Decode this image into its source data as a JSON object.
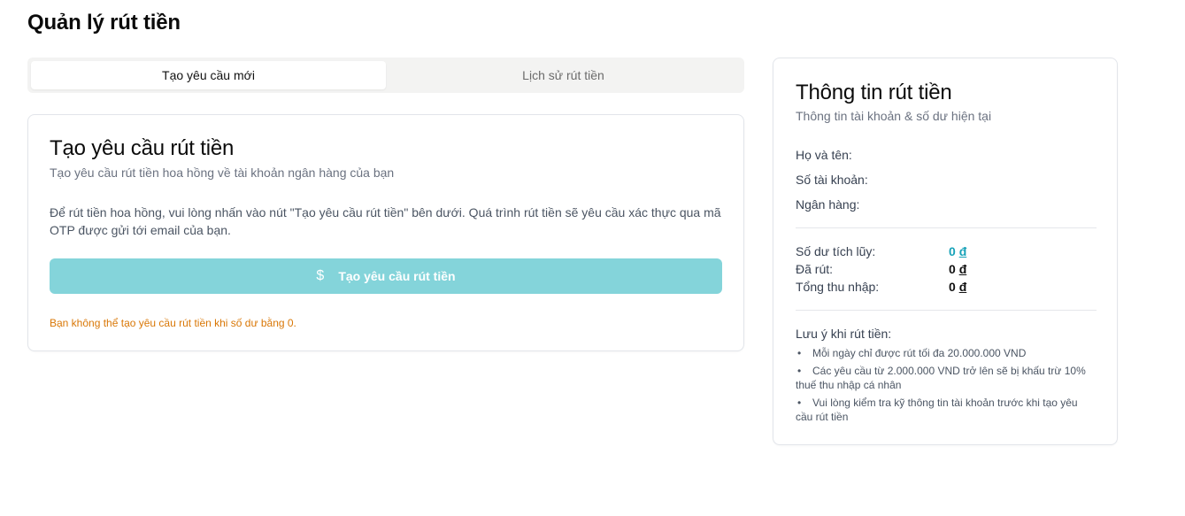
{
  "page": {
    "title": "Quản lý rút tiền"
  },
  "tabs": [
    {
      "label": "Tạo yêu cầu mới",
      "active": true
    },
    {
      "label": "Lịch sử rút tiền",
      "active": false
    }
  ],
  "request_card": {
    "title": "Tạo yêu cầu rút tiền",
    "subtitle": "Tạo yêu cầu rút tiền hoa hồng về tài khoản ngân hàng của bạn",
    "description": "Để rút tiền hoa hồng, vui lòng nhấn vào nút \"Tạo yêu cầu rút tiền\" bên dưới. Quá trình rút tiền sẽ yêu cầu xác thực qua mã OTP được gửi tới email của bạn.",
    "button_label": "Tạo yêu cầu rút tiền",
    "button_icon": "dollar-icon",
    "button_disabled": true,
    "warning": "Bạn không thể tạo yêu cầu rút tiền khi số dư bằng 0."
  },
  "info_card": {
    "title": "Thông tin rút tiền",
    "subtitle": "Thông tin tài khoản & số dư hiện tại",
    "account": {
      "name_label": "Họ và tên:",
      "account_number_label": "Số tài khoản:",
      "bank_label": "Ngân hàng:"
    },
    "balances": [
      {
        "label": "Số dư tích lũy:",
        "amount": "0",
        "currency": "đ",
        "accent": true
      },
      {
        "label": "Đã rút:",
        "amount": "0",
        "currency": "đ",
        "accent": false
      },
      {
        "label": "Tổng thu nhập:",
        "amount": "0",
        "currency": "đ",
        "accent": false
      }
    ],
    "notes_title": "Lưu ý khi rút tiền:",
    "notes": [
      "Mỗi ngày chỉ được rút tối đa 20.000.000 VND",
      "Các yêu cầu từ 2.000.000 VND trở lên sẽ bị khấu trừ 10% thuế thu nhập cá nhân",
      "Vui lòng kiểm tra kỹ thông tin tài khoản trước khi tạo yêu cầu rút tiền"
    ]
  },
  "colors": {
    "accent": "#17a2b8",
    "button_disabled_bg": "#84d4da",
    "warning": "#d97706"
  }
}
